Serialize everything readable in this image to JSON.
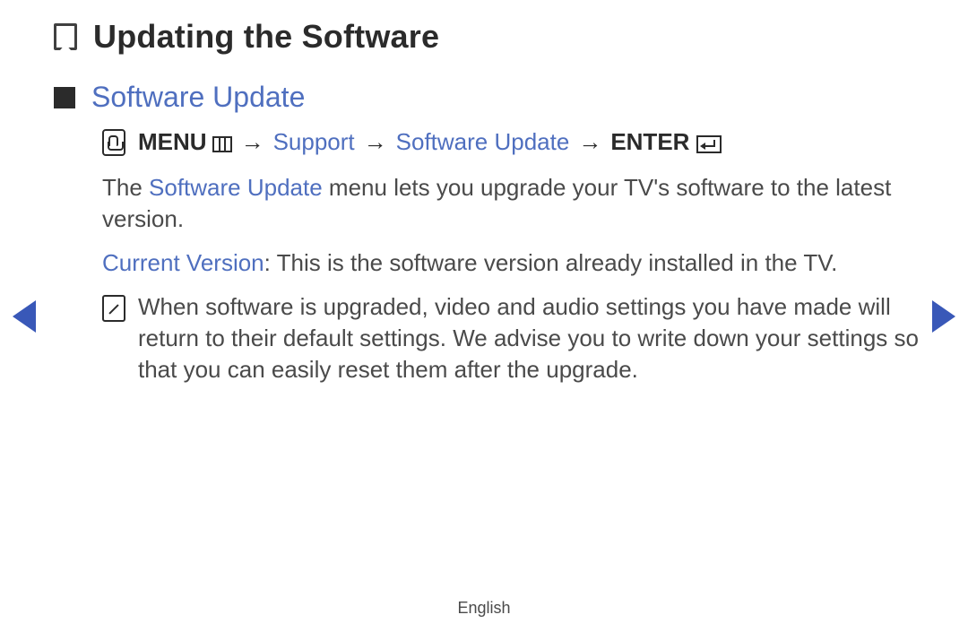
{
  "page": {
    "title": "Updating the Software",
    "language": "English"
  },
  "section": {
    "title": "Software Update"
  },
  "menupath": {
    "menu_label": "MENU",
    "arrow": "→",
    "item1": "Support",
    "item2": "Software Update",
    "enter_label": "ENTER"
  },
  "paragraphs": {
    "intro_pre": "The ",
    "intro_highlight": "Software Update",
    "intro_post": " menu lets you upgrade your TV's software to the latest version.",
    "current_label": "Current Version",
    "current_sep": ": ",
    "current_text": "This is the software version already installed in the TV.",
    "note": "When software is upgraded, video and audio settings you have made will return to their default settings. We advise you to write down your settings so that you can easily reset them after the upgrade."
  }
}
